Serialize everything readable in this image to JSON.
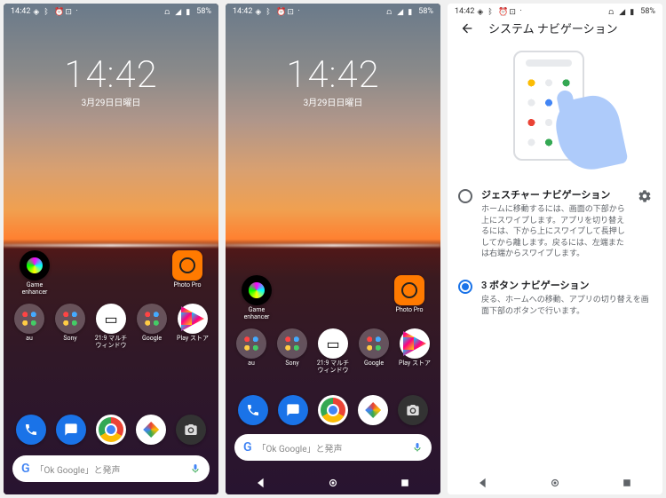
{
  "status": {
    "time": "14:42",
    "battery": "58%",
    "icons_left": [
      "nfc",
      "bt",
      "alarm",
      "dnd"
    ],
    "icons_right": [
      "vowifi",
      "signal",
      "battery"
    ]
  },
  "clock": {
    "time": "14:42",
    "date": "3月29日日曜日"
  },
  "apps": {
    "game_enhancer": "Game enhancer",
    "photo_pro": "Photo Pro",
    "au": "au",
    "sony": "Sony",
    "multiwindow": "21:9 マルチウィンドウ",
    "google": "Google",
    "play": "Play ストア"
  },
  "search": {
    "placeholder": "「Ok Google」と発声"
  },
  "settings": {
    "title": "システム ナビゲーション",
    "opt1": {
      "title": "ジェスチャー ナビゲーション",
      "desc": "ホームに移動するには、画面の下部から上にスワイプします。アプリを切り替えるには、下から上にスワイプして長押ししてから離します。戻るには、左端または右端からスワイプします。"
    },
    "opt2": {
      "title": "3 ボタン ナビゲーション",
      "desc": "戻る、ホームへの移動、アプリの切り替えを画面下部のボタンで行います。"
    }
  }
}
